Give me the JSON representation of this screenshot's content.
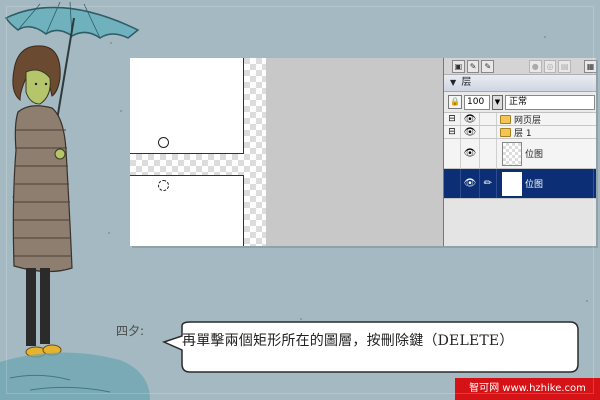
{
  "layers_panel": {
    "title": "层",
    "opacity": "100",
    "blend_mode": "正常",
    "rows": [
      {
        "name": "网页层",
        "type": "web-layer-folder",
        "expand": "⊟",
        "eye": false
      },
      {
        "name": "层 1",
        "type": "layer-folder",
        "expand": "⊟",
        "eye": true
      },
      {
        "name": "位图",
        "type": "bitmap",
        "eye": true,
        "selected": false
      },
      {
        "name": "位图",
        "type": "bitmap",
        "eye": true,
        "selected": true
      }
    ]
  },
  "instruction": {
    "author": "四夕:",
    "text": "再單擊兩個矩形所在的圖層，按刪除鍵（DELETE）"
  },
  "watermark": {
    "text": "智可网 www.hzhike.com"
  },
  "colors": {
    "background": "#a4b9c1",
    "selection": "#0b2e74",
    "watermark": "#d51216"
  }
}
